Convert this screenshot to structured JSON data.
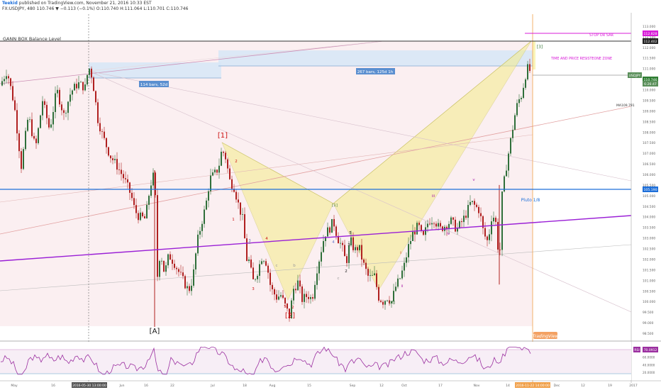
{
  "header": {
    "publisher": "Teekid",
    "published_text": "published on TradingView.com, November 21, 2016 10:33 EST",
    "symbol_line": "FX:USDJPY, 480  110.746 ▼ −0.113 (−0.1%)  O:110.740  H:111.064  L:110.701  C:110.746"
  },
  "chart_data": {
    "type": "candlestick",
    "symbol": "FX:USDJPY",
    "interval": "480",
    "ylim": [
      98.5,
      113.5
    ],
    "price_ticks": [
      "113.000",
      "112.500",
      "112.000",
      "111.500",
      "111.000",
      "110.500",
      "110.000",
      "109.500",
      "109.000",
      "108.500",
      "108.000",
      "107.500",
      "107.000",
      "106.500",
      "106.000",
      "105.500",
      "105.000",
      "104.500",
      "104.000",
      "103.500",
      "103.000",
      "102.500",
      "102.000",
      "101.500",
      "101.000",
      "100.500",
      "100.000",
      "99.500",
      "99.000",
      "98.500"
    ],
    "time_labels": [
      "May",
      "16",
      "2016-05-30 13:00:00",
      "Jun",
      "16",
      "22",
      "Jul",
      "18",
      "Aug",
      "15",
      "Sep",
      "12",
      "Oct",
      "17",
      "Nov",
      "14",
      "2016-11-22 14:00:00",
      "Dec",
      "12",
      "19",
      "2017"
    ],
    "price_badges": [
      {
        "label": "112.828",
        "color": "#d81bd8"
      },
      {
        "label": "112.402",
        "color": "#222222"
      },
      {
        "label": "USDJPY",
        "color": "#5a8f5a"
      },
      {
        "label": "110.746",
        "color": "#2e7d32"
      },
      {
        "label": "6:26:47",
        "color": "#5a8f5a"
      },
      {
        "label": "105.190",
        "color": "#1e6fd9"
      }
    ],
    "ma_label": "MA",
    "ma_value": "109.791",
    "rsi_label": "RSI",
    "rsi_value": "70.0912",
    "rsi_ticks": [
      "80.0000",
      "60.0000",
      "40.0000",
      "20.0000"
    ],
    "price_path": [
      [
        0,
        110.2
      ],
      [
        10,
        110.9
      ],
      [
        20,
        109.3
      ],
      [
        30,
        106.4
      ],
      [
        40,
        108.8
      ],
      [
        50,
        107.2
      ],
      [
        60,
        109.5
      ],
      [
        70,
        108.1
      ],
      [
        80,
        110.0
      ],
      [
        90,
        108.8
      ],
      [
        100,
        109.9
      ],
      [
        110,
        110.3
      ],
      [
        120,
        110.1
      ],
      [
        125,
        111.1
      ],
      [
        130,
        110.6
      ],
      [
        138,
        108.6
      ],
      [
        145,
        107.8
      ],
      [
        155,
        106.9
      ],
      [
        165,
        106.4
      ],
      [
        175,
        105.8
      ],
      [
        185,
        105.0
      ],
      [
        190,
        104.3
      ],
      [
        196,
        104.0
      ],
      [
        205,
        103.9
      ],
      [
        212,
        105.5
      ],
      [
        218,
        106.1
      ],
      [
        222,
        101.2
      ],
      [
        226,
        102.4
      ],
      [
        232,
        101.3
      ],
      [
        238,
        102.2
      ],
      [
        246,
        101.8
      ],
      [
        252,
        101.4
      ],
      [
        258,
        101.0
      ],
      [
        266,
        100.5
      ],
      [
        272,
        101.1
      ],
      [
        278,
        102.8
      ],
      [
        284,
        103.7
      ],
      [
        290,
        104.5
      ],
      [
        296,
        105.8
      ],
      [
        302,
        106.0
      ],
      [
        308,
        106.3
      ],
      [
        313,
        107.2
      ],
      [
        318,
        106.8
      ],
      [
        324,
        105.7
      ],
      [
        330,
        105.4
      ],
      [
        336,
        104.6
      ],
      [
        342,
        103.9
      ],
      [
        348,
        102.0
      ],
      [
        352,
        101.9
      ],
      [
        356,
        100.9
      ],
      [
        362,
        101.3
      ],
      [
        370,
        102.2
      ],
      [
        376,
        101.8
      ],
      [
        382,
        100.6
      ],
      [
        390,
        100.2
      ],
      [
        396,
        100.3
      ],
      [
        402,
        99.8
      ],
      [
        408,
        99.3
      ],
      [
        414,
        100.6
      ],
      [
        420,
        100.9
      ],
      [
        426,
        100.1
      ],
      [
        434,
        100.3
      ],
      [
        440,
        100.1
      ],
      [
        446,
        101.4
      ],
      [
        452,
        102.3
      ],
      [
        458,
        103.2
      ],
      [
        464,
        103.4
      ],
      [
        470,
        103.8
      ],
      [
        476,
        103.0
      ],
      [
        482,
        102.6
      ],
      [
        488,
        101.8
      ],
      [
        494,
        102.9
      ],
      [
        500,
        102.4
      ],
      [
        506,
        102.6
      ],
      [
        512,
        101.8
      ],
      [
        520,
        101.1
      ],
      [
        528,
        101.2
      ],
      [
        534,
        100.2
      ],
      [
        540,
        100.0
      ],
      [
        546,
        100.2
      ],
      [
        552,
        100.0
      ],
      [
        558,
        100.7
      ],
      [
        564,
        101.1
      ],
      [
        570,
        101.7
      ],
      [
        576,
        102.6
      ],
      [
        582,
        103.2
      ],
      [
        590,
        103.6
      ],
      [
        596,
        102.9
      ],
      [
        604,
        103.8
      ],
      [
        612,
        103.9
      ],
      [
        620,
        103.4
      ],
      [
        628,
        103.6
      ],
      [
        636,
        103.8
      ],
      [
        644,
        103.4
      ],
      [
        652,
        103.8
      ],
      [
        658,
        104.2
      ],
      [
        664,
        104.7
      ],
      [
        670,
        104.5
      ],
      [
        676,
        104.3
      ],
      [
        682,
        103.2
      ],
      [
        688,
        102.8
      ],
      [
        694,
        104.2
      ],
      [
        700,
        103.6
      ],
      [
        704,
        101.6
      ],
      [
        708,
        105.0
      ],
      [
        714,
        106.4
      ],
      [
        720,
        107.6
      ],
      [
        726,
        108.8
      ],
      [
        730,
        109.4
      ],
      [
        736,
        109.8
      ],
      [
        740,
        110.6
      ],
      [
        745,
        111.1
      ],
      [
        749,
        110.7
      ]
    ],
    "horizontal_levels": [
      {
        "price": 105.19,
        "color": "#1e6fd9"
      },
      {
        "price": 112.402,
        "color": "#222222"
      },
      {
        "price": 112.828,
        "color": "#d81bd8"
      }
    ]
  },
  "annotations": {
    "gann_title": "GANN BOX Balance Level",
    "range_label_1": "114 bars, 52d",
    "range_label_2": "267 bars, 125d 1h",
    "stop_label": "STOP OR SAR",
    "zone_label": "TIME AND PRICE RESISTEONE ZONE",
    "pluto_label": "Pluto 1/8",
    "wave_1": "[1]",
    "wave_2": "[2]",
    "wave_A": "[A]",
    "wave_3": "[3]",
    "wave_1_small": "[1]",
    "wave_2_small": "[2]",
    "small_labels": [
      {
        "t": "2",
        "color": "#cc1111"
      },
      {
        "t": "1",
        "color": "#cc1111"
      },
      {
        "t": "4",
        "color": "#cc1111"
      },
      {
        "t": "3",
        "color": "#cc1111"
      },
      {
        "t": "5",
        "color": "#cc1111"
      },
      {
        "t": "2",
        "color": "#cc1111"
      },
      {
        "t": "2",
        "color": "#222222"
      },
      {
        "t": "5",
        "color": "#222222"
      },
      {
        "t": "3",
        "color": "#222222"
      },
      {
        "t": "i",
        "color": "#cc1111"
      },
      {
        "t": "ii",
        "color": "#aa22aa"
      },
      {
        "t": "iii",
        "color": "#aa22aa"
      },
      {
        "t": "iv",
        "color": "#aa22aa"
      },
      {
        "t": "v",
        "color": "#aa22aa"
      },
      {
        "t": "4",
        "color": "#6677cc"
      },
      {
        "t": "3",
        "color": "#6677cc"
      },
      {
        "t": "c",
        "color": "#999999"
      },
      {
        "t": "a",
        "color": "#999999"
      },
      {
        "t": "b",
        "color": "#999999"
      },
      {
        "t": "c",
        "color": "#999999"
      }
    ],
    "logo_text": "TradingView"
  },
  "colors": {
    "background": "#ffffff",
    "bull": "#2f6f3a",
    "bear": "#b02020",
    "gann_box": "#fbeff0",
    "harmonic_fill": "#f5ec8a",
    "blue_line": "#1e6fd9",
    "purple_line": "#9a1fd6",
    "rsi_line": "#9b2fa0",
    "magenta": "#d81bd8"
  }
}
